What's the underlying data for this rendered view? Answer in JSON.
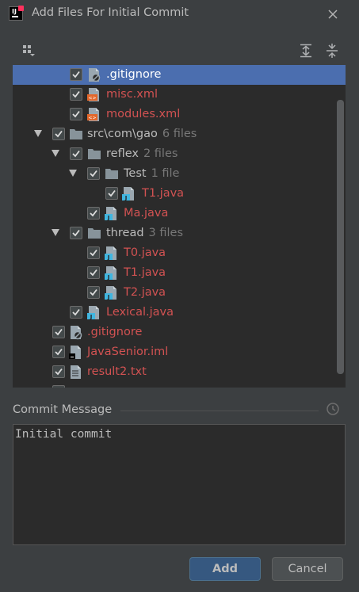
{
  "dialog": {
    "title": "Add Files For Initial Commit"
  },
  "toolbar": {
    "left_icon": "group-by-icon",
    "expand_icon": "expand-all-icon",
    "collapse_icon": "collapse-all-icon"
  },
  "tree": [
    {
      "name": ".gitignore",
      "count": "",
      "type": "ignore",
      "color": "white",
      "selected": true,
      "checked": true,
      "expanded": null
    },
    {
      "name": "misc.xml",
      "count": "",
      "type": "xml",
      "color": "red",
      "selected": false,
      "checked": true,
      "expanded": null
    },
    {
      "name": "modules.xml",
      "count": "",
      "type": "xml",
      "color": "red",
      "selected": false,
      "checked": true,
      "expanded": null
    },
    {
      "name": "src\\com\\gao",
      "count": "6 files",
      "type": "folder",
      "color": "white",
      "selected": false,
      "checked": true,
      "expanded": true
    },
    {
      "name": "reflex",
      "count": "2 files",
      "type": "folder",
      "color": "white",
      "selected": false,
      "checked": true,
      "expanded": true
    },
    {
      "name": "Test",
      "count": "1 file",
      "type": "folder",
      "color": "white",
      "selected": false,
      "checked": true,
      "expanded": true
    },
    {
      "name": "T1.java",
      "count": "",
      "type": "java",
      "color": "red",
      "selected": false,
      "checked": true,
      "expanded": null
    },
    {
      "name": "Ma.java",
      "count": "",
      "type": "java",
      "color": "red",
      "selected": false,
      "checked": true,
      "expanded": null
    },
    {
      "name": "thread",
      "count": "3 files",
      "type": "folder",
      "color": "white",
      "selected": false,
      "checked": true,
      "expanded": true
    },
    {
      "name": "T0.java",
      "count": "",
      "type": "java",
      "color": "red",
      "selected": false,
      "checked": true,
      "expanded": null
    },
    {
      "name": "T1.java",
      "count": "",
      "type": "java",
      "color": "red",
      "selected": false,
      "checked": true,
      "expanded": null
    },
    {
      "name": "T2.java",
      "count": "",
      "type": "java",
      "color": "red",
      "selected": false,
      "checked": true,
      "expanded": null
    },
    {
      "name": "Lexical.java",
      "count": "",
      "type": "java",
      "color": "red",
      "selected": false,
      "checked": true,
      "expanded": null
    },
    {
      "name": ".gitignore",
      "count": "",
      "type": "ignore",
      "color": "red",
      "selected": false,
      "checked": true,
      "expanded": null
    },
    {
      "name": "JavaSenior.iml",
      "count": "",
      "type": "iml",
      "color": "red",
      "selected": false,
      "checked": true,
      "expanded": null
    },
    {
      "name": "result2.txt",
      "count": "",
      "type": "txt",
      "color": "red",
      "selected": false,
      "checked": true,
      "expanded": null
    }
  ],
  "commit": {
    "label": "Commit Message",
    "value": "Initial commit",
    "history_icon": "clock-icon"
  },
  "buttons": {
    "add": "Add",
    "cancel": "Cancel"
  },
  "colors": {
    "background": "#3c3f41",
    "tree_bg": "#2b2b2b",
    "selection": "#4b6eaf",
    "unversioned": "#d25252",
    "primary_button": "#365880"
  }
}
